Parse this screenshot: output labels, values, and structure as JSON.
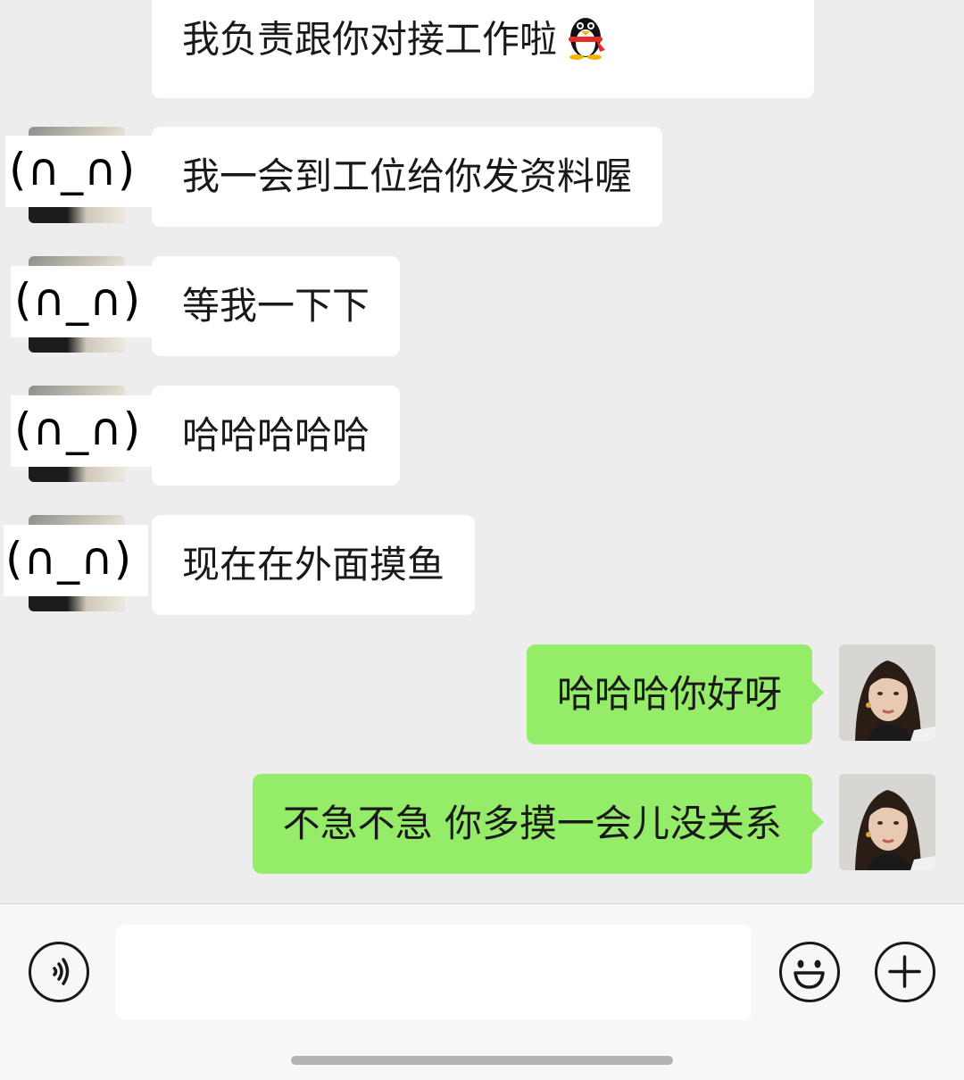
{
  "colors": {
    "background": "#ededed",
    "incoming_bubble": "#ffffff",
    "outgoing_bubble": "#95ec69",
    "text": "#191919"
  },
  "messages": [
    {
      "direction": "in",
      "text_partial_top": "...",
      "text": "我负责跟你对接工作啦",
      "emoji": "qq-penguin-icon"
    },
    {
      "direction": "in",
      "avatar_overlay": "(∩_∩)",
      "text": "我一会到工位给你发资料喔"
    },
    {
      "direction": "in",
      "avatar_overlay": "(∩_∩)",
      "text": "等我一下下"
    },
    {
      "direction": "in",
      "avatar_overlay": "(∩_∩)",
      "text": "哈哈哈哈哈"
    },
    {
      "direction": "in",
      "avatar_overlay": "(∩_∩)",
      "text": "现在在外面摸鱼"
    },
    {
      "direction": "out",
      "text": "哈哈哈你好呀"
    },
    {
      "direction": "out",
      "text": "不急不急 你多摸一会儿没关系"
    }
  ],
  "input": {
    "value": "",
    "placeholder": ""
  },
  "icons": {
    "voice": "voice-icon",
    "emoji": "emoji-icon",
    "more": "plus-icon"
  }
}
